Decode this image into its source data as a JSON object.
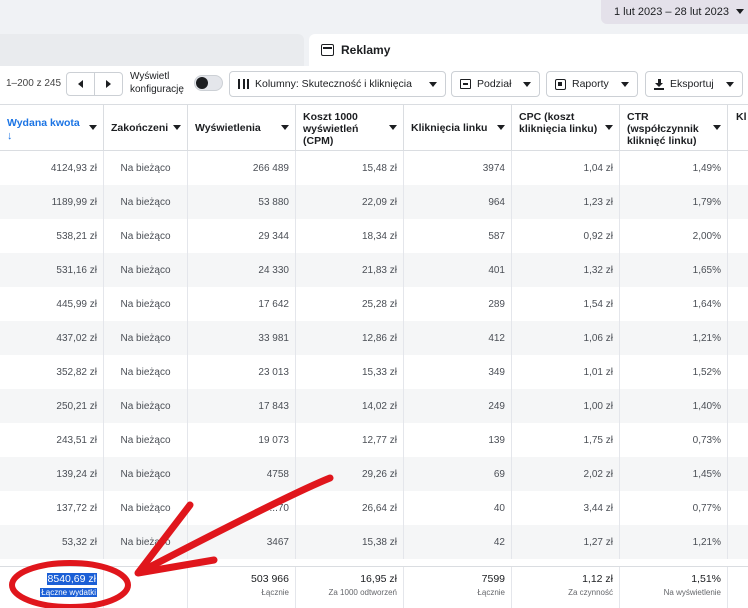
{
  "date_range": "1 lut 2023 – 28 lut 2023",
  "tab": {
    "label": "Reklamy"
  },
  "toolbar": {
    "range": "1–200 z 245",
    "config_label": "Wyświetl konfigurację",
    "columns_btn": "Kolumny: Skuteczność i kliknięcia",
    "breakdown_btn": "Podział",
    "reports_btn": "Raporty",
    "export_btn": "Eksportuj"
  },
  "headers": {
    "spend": "Wydana kwota",
    "sort_arrow": "↓",
    "ends": "Zakończeni",
    "impressions": "Wyświetlenia",
    "cpm": "Koszt 1000 wyświetleń (CPM)",
    "clicks": "Kliknięcia linku",
    "cpc": "CPC (koszt kliknięcia linku)",
    "ctr": "CTR (współczynnik kliknięć linku)",
    "extra": "Kl (w"
  },
  "rows": [
    {
      "spend": "4124,93 zł",
      "ends": "Na bieżąco",
      "impressions": "266 489",
      "cpm": "15,48 zł",
      "clicks": "3974",
      "cpc": "1,04 zł",
      "ctr": "1,49%"
    },
    {
      "spend": "1189,99 zł",
      "ends": "Na bieżąco",
      "impressions": "53 880",
      "cpm": "22,09 zł",
      "clicks": "964",
      "cpc": "1,23 zł",
      "ctr": "1,79%"
    },
    {
      "spend": "538,21 zł",
      "ends": "Na bieżąco",
      "impressions": "29 344",
      "cpm": "18,34 zł",
      "clicks": "587",
      "cpc": "0,92 zł",
      "ctr": "2,00%"
    },
    {
      "spend": "531,16 zł",
      "ends": "Na bieżąco",
      "impressions": "24 330",
      "cpm": "21,83 zł",
      "clicks": "401",
      "cpc": "1,32 zł",
      "ctr": "1,65%"
    },
    {
      "spend": "445,99 zł",
      "ends": "Na bieżąco",
      "impressions": "17 642",
      "cpm": "25,28 zł",
      "clicks": "289",
      "cpc": "1,54 zł",
      "ctr": "1,64%"
    },
    {
      "spend": "437,02 zł",
      "ends": "Na bieżąco",
      "impressions": "33 981",
      "cpm": "12,86 zł",
      "clicks": "412",
      "cpc": "1,06 zł",
      "ctr": "1,21%"
    },
    {
      "spend": "352,82 zł",
      "ends": "Na bieżąco",
      "impressions": "23 013",
      "cpm": "15,33 zł",
      "clicks": "349",
      "cpc": "1,01 zł",
      "ctr": "1,52%"
    },
    {
      "spend": "250,21 zł",
      "ends": "Na bieżąco",
      "impressions": "17 843",
      "cpm": "14,02 zł",
      "clicks": "249",
      "cpc": "1,00 zł",
      "ctr": "1,40%"
    },
    {
      "spend": "243,51 zł",
      "ends": "Na bieżąco",
      "impressions": "19 073",
      "cpm": "12,77 zł",
      "clicks": "139",
      "cpc": "1,75 zł",
      "ctr": "0,73%"
    },
    {
      "spend": "139,24 zł",
      "ends": "Na bieżąco",
      "impressions": "4758",
      "cpm": "29,26 zł",
      "clicks": "69",
      "cpc": "2,02 zł",
      "ctr": "1,45%"
    },
    {
      "spend": "137,72 zł",
      "ends": "Na bieżąco",
      "impressions": "...70",
      "cpm": "26,64 zł",
      "clicks": "40",
      "cpc": "3,44 zł",
      "ctr": "0,77%"
    },
    {
      "spend": "53,32 zł",
      "ends": "Na bieżąco",
      "impressions": "3467",
      "cpm": "15,38 zł",
      "clicks": "42",
      "cpc": "1,27 zł",
      "ctr": "1,21%"
    }
  ],
  "totals": {
    "spend": "8540,69 zł",
    "spend_label": "Łączne wydatki",
    "impressions": "503 966",
    "impressions_label": "Łącznie",
    "cpm": "16,95 zł",
    "cpm_label": "Za 1000 odtworzeń",
    "clicks": "7599",
    "clicks_label": "Łącznie",
    "cpc": "1,12 zł",
    "cpc_label": "Za czynność",
    "ctr": "1,51%",
    "ctr_label": "Na wyświetlenie"
  },
  "annotation": {
    "color": "#e0161c"
  }
}
